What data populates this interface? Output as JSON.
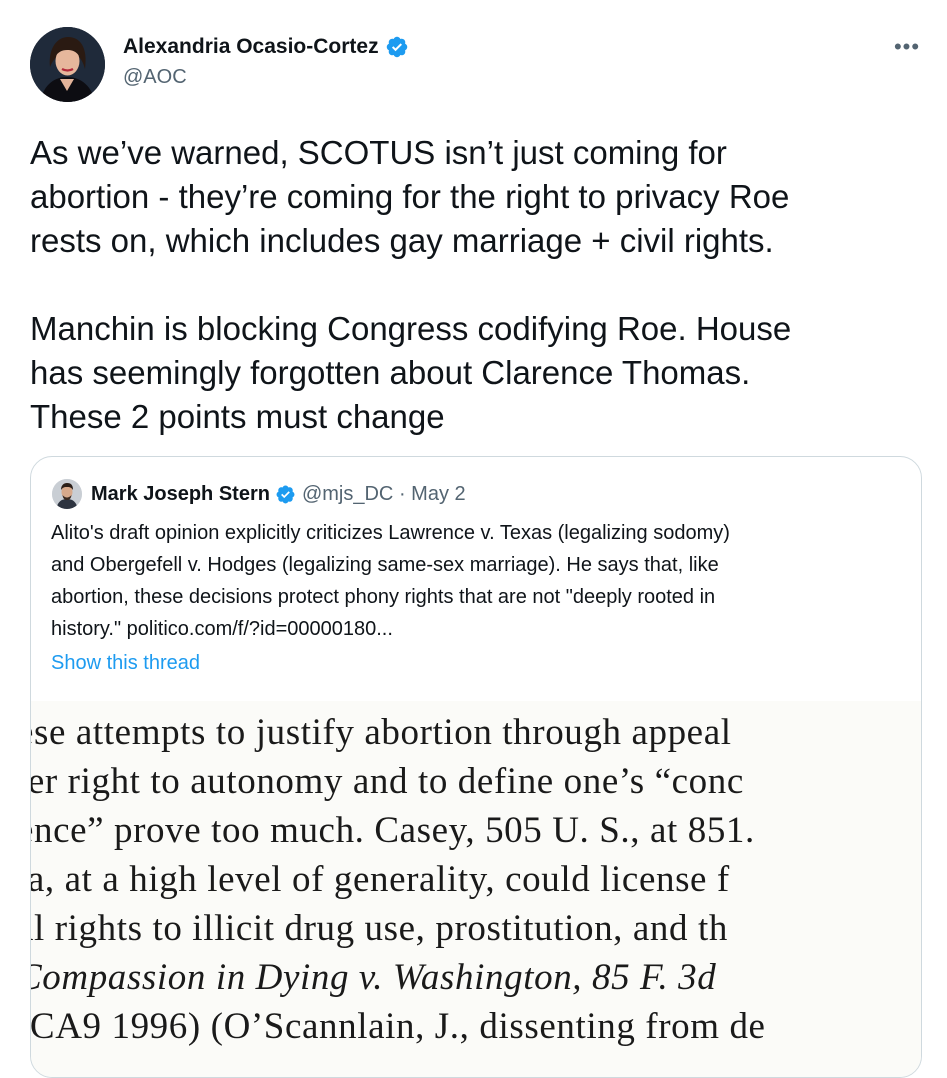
{
  "tweet": {
    "author_name": "Alexandria Ocasio-Cortez",
    "author_handle": "@AOC",
    "more_icon": "more-horizontal-icon",
    "text_paragraphs": [
      [
        "As we’ve warned, SCOTUS isn’t just coming for",
        "abortion - they’re coming for the right to privacy Roe",
        "rests on, which includes gay marriage + civil rights."
      ],
      [
        "Manchin is blocking Congress codifying Roe. House",
        "has seemingly forgotten about Clarence Thomas.",
        "These 2 points must change"
      ]
    ]
  },
  "quoted_tweet": {
    "author_name": "Mark Joseph Stern",
    "author_handle": "@mjs_DC",
    "separator": "·",
    "date": "May 2",
    "text_lines": [
      "Alito's draft opinion explicitly criticizes Lawrence v. Texas (legalizing sodomy)",
      "and Obergefell v. Hodges (legalizing same-sex marriage). He says that, like",
      "abortion, these decisions protect phony rights that are not \"deeply rooted in",
      "history.\" politico.com/f/?id=00000180..."
    ],
    "show_thread": "Show this thread",
    "document_lines": [
      "ese attempts to justify abortion through appeal",
      "ler right to autonomy and to define one’s “conc",
      "ence” prove too much.  Casey, 505 U. S., at 851.",
      "ia, at a high level of generality, could license f",
      "al rights to illicit drug use, prostitution, and th",
      "Compassion in Dying v. Washington, 85 F. 3d",
      "(CA9 1996) (O’Scannlain, J., dissenting from de"
    ]
  },
  "colors": {
    "verified": "#1d9bf0",
    "link": "#1d9bf0",
    "secondary_text": "#536471",
    "border": "#cfd9de"
  }
}
